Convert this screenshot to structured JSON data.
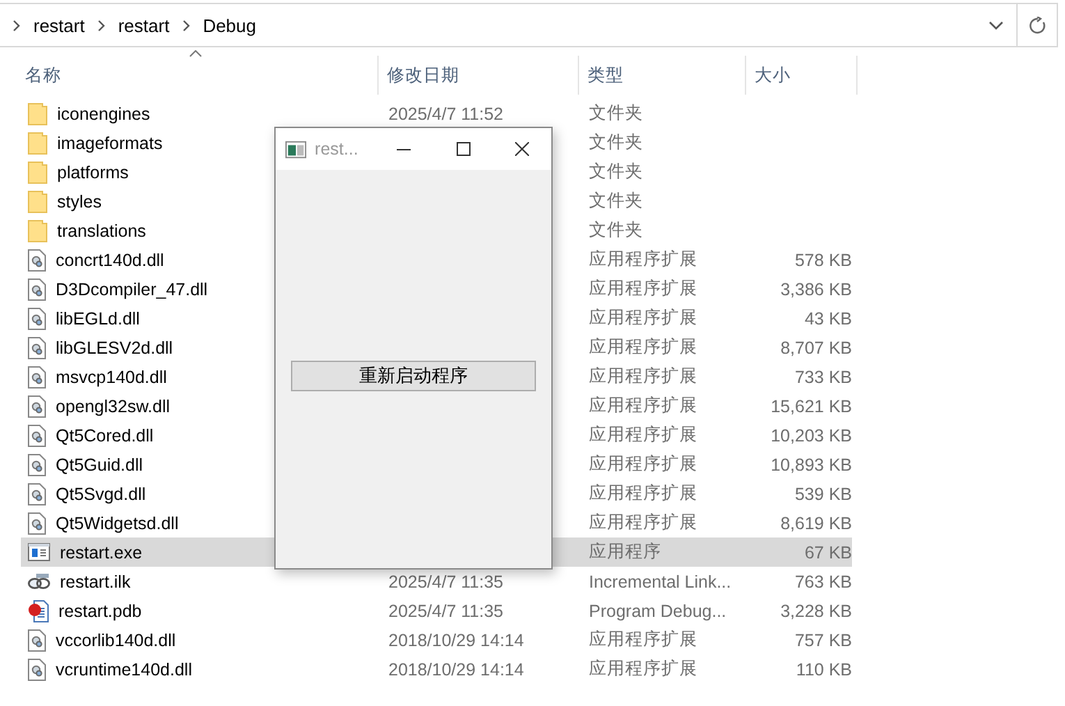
{
  "address_bar": {
    "path": [
      "restart",
      "restart",
      "Debug"
    ]
  },
  "columns": [
    {
      "label": "名称",
      "sorted": true
    },
    {
      "label": "修改日期",
      "sorted": false
    },
    {
      "label": "类型",
      "sorted": false
    },
    {
      "label": "大小",
      "sorted": false
    }
  ],
  "files": [
    {
      "name": "iconengines",
      "date": "2025/4/7 11:52",
      "type": "文件夹",
      "kind": "folder",
      "selected": false
    },
    {
      "name": "imageformats",
      "type": "文件夹",
      "kind": "folder",
      "selected": false
    },
    {
      "name": "platforms",
      "type": "文件夹",
      "kind": "folder",
      "selected": false
    },
    {
      "name": "styles",
      "type": "文件夹",
      "kind": "folder",
      "selected": false
    },
    {
      "name": "translations",
      "type": "文件夹",
      "kind": "folder",
      "selected": false
    },
    {
      "name": "concrt140d.dll",
      "type": "应用程序扩展",
      "size": "578 KB",
      "kind": "dll",
      "selected": false
    },
    {
      "name": "D3Dcompiler_47.dll",
      "type": "应用程序扩展",
      "size": "3,386 KB",
      "kind": "dll",
      "selected": false
    },
    {
      "name": "libEGLd.dll",
      "type": "应用程序扩展",
      "size": "43 KB",
      "kind": "dll",
      "selected": false
    },
    {
      "name": "libGLESV2d.dll",
      "type": "应用程序扩展",
      "size": "8,707 KB",
      "kind": "dll",
      "selected": false
    },
    {
      "name": "msvcp140d.dll",
      "type": "应用程序扩展",
      "size": "733 KB",
      "kind": "dll",
      "selected": false
    },
    {
      "name": "opengl32sw.dll",
      "type": "应用程序扩展",
      "size": "15,621 KB",
      "kind": "dll",
      "selected": false
    },
    {
      "name": "Qt5Cored.dll",
      "type": "应用程序扩展",
      "size": "10,203 KB",
      "kind": "dll",
      "selected": false
    },
    {
      "name": "Qt5Guid.dll",
      "type": "应用程序扩展",
      "size": "10,893 KB",
      "kind": "dll",
      "selected": false
    },
    {
      "name": "Qt5Svgd.dll",
      "type": "应用程序扩展",
      "size": "539 KB",
      "kind": "dll",
      "selected": false
    },
    {
      "name": "Qt5Widgetsd.dll",
      "type": "应用程序扩展",
      "size": "8,619 KB",
      "kind": "dll",
      "selected": false
    },
    {
      "name": "restart.exe",
      "type": "应用程序",
      "size": "67 KB",
      "kind": "exe",
      "selected": true
    },
    {
      "name": "restart.ilk",
      "date": "2025/4/7 11:35",
      "type": "Incremental Link...",
      "size": "763 KB",
      "kind": "ilk",
      "selected": false
    },
    {
      "name": "restart.pdb",
      "date": "2025/4/7 11:35",
      "type": "Program Debug...",
      "size": "3,228 KB",
      "kind": "pdb",
      "selected": false
    },
    {
      "name": "vccorlib140d.dll",
      "date": "2018/10/29 14:14",
      "type": "应用程序扩展",
      "size": "757 KB",
      "kind": "dll",
      "selected": false
    },
    {
      "name": "vcruntime140d.dll",
      "date": "2018/10/29 14:14",
      "type": "应用程序扩展",
      "size": "110 KB",
      "kind": "dll",
      "selected": false
    }
  ],
  "dialog": {
    "title": "rest...",
    "button": "重新启动程序"
  }
}
